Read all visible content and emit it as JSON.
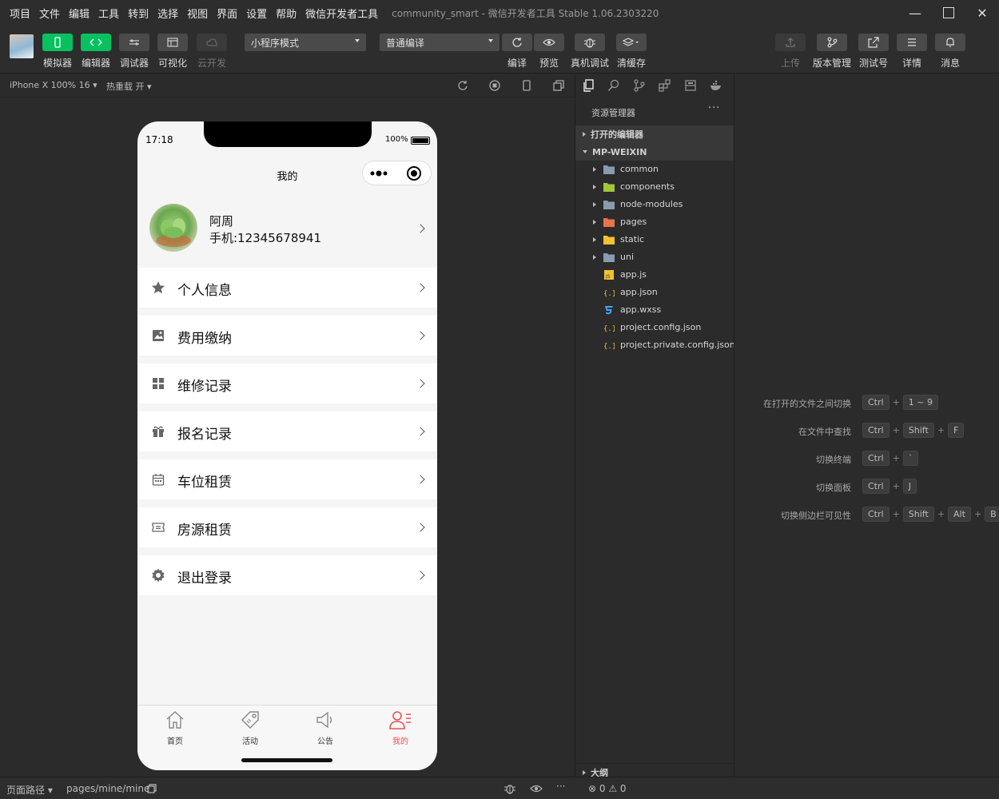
{
  "menu": [
    "项目",
    "文件",
    "编辑",
    "工具",
    "转到",
    "选择",
    "视图",
    "界面",
    "设置",
    "帮助",
    "微信开发者工具"
  ],
  "window": {
    "project": "community_smart",
    "app_title": "- 微信开发者工具 Stable 1.06.2303220"
  },
  "toolbar": {
    "left_buttons": [
      {
        "label": "模拟器",
        "icon": "phone-icon",
        "active": true
      },
      {
        "label": "编辑器",
        "icon": "code-icon",
        "active": true
      },
      {
        "label": "调试器",
        "icon": "sliders-icon",
        "active": false
      },
      {
        "label": "可视化",
        "icon": "layout-icon",
        "active": false
      },
      {
        "label": "云开发",
        "icon": "cloud-icon",
        "active": false,
        "disabled": true
      }
    ],
    "mode_select": "小程序模式",
    "compile_select": "普通编译",
    "mid_buttons": [
      {
        "label": "编译",
        "icon": "refresh-icon"
      },
      {
        "label": "预览",
        "icon": "eye-icon"
      },
      {
        "label": "真机调试",
        "icon": "bug-icon"
      },
      {
        "label": "清缓存",
        "icon": "layers-icon"
      }
    ],
    "right_buttons": [
      {
        "label": "上传",
        "icon": "upload-icon",
        "disabled": true
      },
      {
        "label": "版本管理",
        "icon": "branch-icon"
      },
      {
        "label": "测试号",
        "icon": "external-icon"
      },
      {
        "label": "详情",
        "icon": "menu-icon"
      },
      {
        "label": "消息",
        "icon": "bell-icon"
      }
    ]
  },
  "simulator": {
    "device": "iPhone X 100% 16 ▾",
    "hot_reload": "热重载 开 ▾",
    "time": "17:18",
    "battery_pct": "100%",
    "nav_title": "我的",
    "user_name": "阿周",
    "user_phone": "手机:12345678941",
    "menu_items": [
      {
        "label": "个人信息",
        "icon": "star-icon"
      },
      {
        "label": "费用缴纳",
        "icon": "image-icon"
      },
      {
        "label": "维修记录",
        "icon": "grid-icon"
      },
      {
        "label": "报名记录",
        "icon": "gift-icon"
      },
      {
        "label": "车位租赁",
        "icon": "calendar-icon"
      },
      {
        "label": "房源租赁",
        "icon": "ticket-icon"
      },
      {
        "label": "退出登录",
        "icon": "gear-icon"
      }
    ],
    "tabs": [
      {
        "label": "首页",
        "icon": "home-icon",
        "active": false
      },
      {
        "label": "活动",
        "icon": "tag-icon",
        "active": false
      },
      {
        "label": "公告",
        "icon": "megaphone-icon",
        "active": false
      },
      {
        "label": "我的",
        "icon": "user-icon",
        "active": true
      }
    ]
  },
  "explorer": {
    "title": "资源管理器",
    "more": "···",
    "open_editors": "打开的编辑器",
    "root": "MP-WEIXIN",
    "files": [
      {
        "name": "common",
        "type": "folder",
        "color": "#8a9bb0"
      },
      {
        "name": "components",
        "type": "folder",
        "color": "#a4c639"
      },
      {
        "name": "node-modules",
        "type": "folder",
        "color": "#8a9bb0"
      },
      {
        "name": "pages",
        "type": "folder",
        "color": "#e8744f"
      },
      {
        "name": "static",
        "type": "folder",
        "color": "#f1c232"
      },
      {
        "name": "uni",
        "type": "folder",
        "color": "#8a9bb0"
      },
      {
        "name": "app.js",
        "type": "js"
      },
      {
        "name": "app.json",
        "type": "json"
      },
      {
        "name": "app.wxss",
        "type": "css"
      },
      {
        "name": "project.config.json",
        "type": "json"
      },
      {
        "name": "project.private.config.json",
        "type": "json"
      }
    ],
    "outline": "大纲"
  },
  "shortcuts": [
    {
      "label": "在打开的文件之间切换",
      "keys": [
        "Ctrl",
        "1 ~ 9"
      ]
    },
    {
      "label": "在文件中查找",
      "keys": [
        "Ctrl",
        "Shift",
        "F"
      ]
    },
    {
      "label": "切换终端",
      "keys": [
        "Ctrl",
        "`"
      ]
    },
    {
      "label": "切换面板",
      "keys": [
        "Ctrl",
        "J"
      ]
    },
    {
      "label": "切换侧边栏可见性",
      "keys": [
        "Ctrl",
        "Shift",
        "Alt",
        "B"
      ]
    }
  ],
  "statusbar": {
    "path_label": "页面路径 ▾",
    "path": "pages/mine/mine",
    "problems": "⊗ 0 ⚠ 0"
  },
  "colors": {
    "accent": "#07c160",
    "tab_active": "#e95252"
  }
}
